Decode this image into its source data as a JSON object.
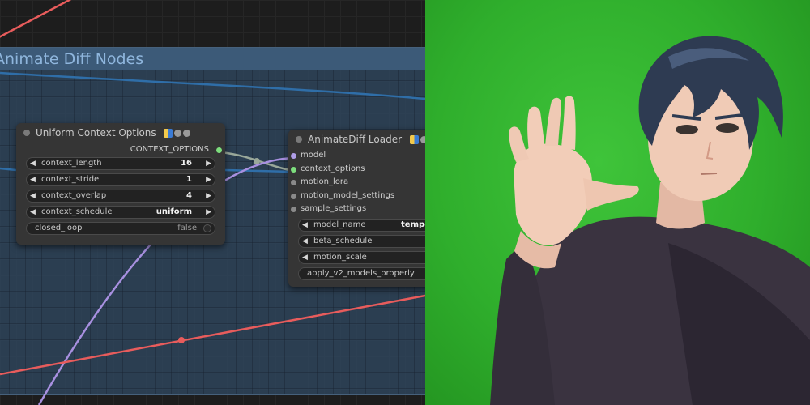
{
  "group": {
    "title": "Animate Diff Nodes"
  },
  "nodes": {
    "context_options": {
      "title": "Uniform Context Options",
      "output": "CONTEXT_OPTIONS",
      "widgets": {
        "context_length": {
          "label": "context_length",
          "value": "16"
        },
        "context_stride": {
          "label": "context_stride",
          "value": "1"
        },
        "context_overlap": {
          "label": "context_overlap",
          "value": "4"
        },
        "context_schedule": {
          "label": "context_schedule",
          "value": "uniform"
        },
        "closed_loop": {
          "label": "closed_loop",
          "value": "false"
        }
      }
    },
    "animatediff_loader": {
      "title": "AnimateDiff Loader",
      "inputs": {
        "model": "model",
        "context_options": "context_options",
        "motion_lora": "motion_lora",
        "motion_model_settings": "motion_model_settings",
        "sample_settings": "sample_settings"
      },
      "widgets": {
        "model_name": {
          "label": "model_name",
          "value": "tempor"
        },
        "beta_schedule": {
          "label": "beta_schedule"
        },
        "motion_scale": {
          "label": "motion_scale"
        },
        "apply_v2": {
          "label": "apply_v2_models_properly"
        }
      }
    }
  },
  "colors": {
    "wire_red": "#e85c5c",
    "wire_blue": "#2f6ea8",
    "wire_purple": "#a890e0",
    "wire_gray": "#9aa89a",
    "socket_green": "#7dde7d",
    "socket_purple": "#b09ee8",
    "socket_gray": "#8a8a8a",
    "green_screen": "#35b832"
  },
  "icons": [
    "node-status-dot",
    "mask-badge-icon",
    "info-badge-icon"
  ]
}
